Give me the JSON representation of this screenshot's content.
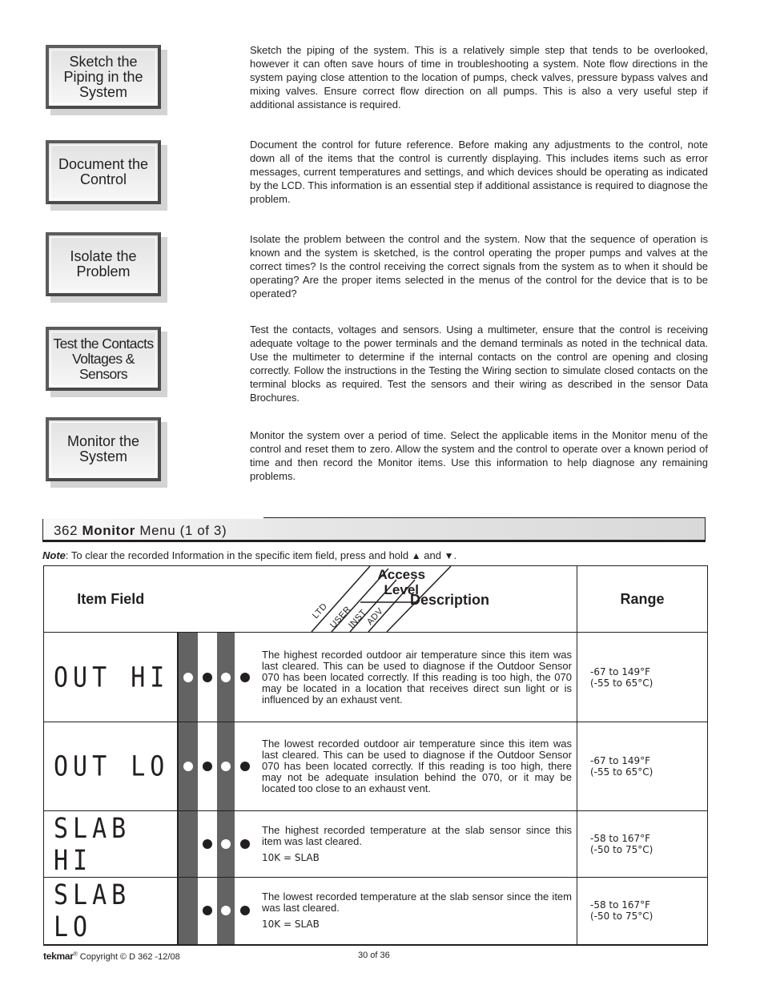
{
  "steps": [
    {
      "label": "Sketch the\nPiping in the\nSystem",
      "description": "Sketch the piping of the system. This is a relatively simple step that tends to be overlooked, however it can often save hours of time in troubleshooting a system. Note flow directions in the system paying close attention to the location of pumps, check valves, pressure bypass valves and mixing valves. Ensure correct flow direction on all pumps. This is also a very useful step if additional assistance is required."
    },
    {
      "label": "Document the\nControl",
      "description": "Document the control for future reference. Before making any adjustments to the control, note down all of the items that the control is currently displaying. This includes items such as error messages, current temperatures and settings, and which devices should be operating as indicated by the LCD. This information is an essential step if additional assistance is required to diagnose the problem."
    },
    {
      "label": "Isolate the\nProblem",
      "description": "Isolate the problem between the control and the system. Now that the sequence of operation is known and the system is sketched, is the control operating the proper pumps and valves at the correct times? Is the control receiving the correct signals from the system as to when it should be operating? Are the proper items selected in the menus of the control for the device that is to be operated?"
    },
    {
      "label": "Test the Contacts\nVoltages &\nSensors",
      "description": "Test the contacts, voltages and sensors. Using a multimeter, ensure that the control is receiving adequate voltage to the power terminals and the demand terminals as noted in the technical data. Use the multimeter to determine if the internal contacts on the control are opening and closing correctly. Follow the instructions in the Testing the Wiring section to simulate closed contacts on the terminal blocks as required. Test the sensors and their wiring as described in the sensor Data Brochures."
    },
    {
      "label": "Monitor the\nSystem",
      "description": "Monitor the system over a period of time. Select the applicable items in the Monitor menu of the control and reset them to zero. Allow the system and the control to operate over a known period of time and then record the Monitor items. Use this information to help diagnose any remaining problems."
    }
  ],
  "section": {
    "number": "362",
    "bold": "Monitor",
    "rest": "Menu (1 of 3)"
  },
  "note": {
    "label": "Note",
    "text": ": To clear the recorded Information in the specific item field, press and hold ",
    "up_icon": "▲",
    "and": " and ",
    "down_icon": "▼",
    "end": "."
  },
  "table": {
    "headers": {
      "item_field": "Item Field",
      "access_level": "Access Level",
      "access_line1": "Access",
      "access_line2": "Level",
      "levels": [
        "LTD",
        "USER",
        "INST",
        "ADV"
      ],
      "description": "Description",
      "range": "Range"
    },
    "rows": [
      {
        "display": "OUT HI",
        "access": [
          true,
          true,
          true,
          true
        ],
        "description": "The highest recorded outdoor air temperature since this item was last cleared. This can be used to diagnose if the Outdoor Sensor 070 has been located correctly. If this reading is too high, the 070 may be located in a location that receives direct sun light or is influenced by an exhaust vent.",
        "sub": "",
        "range_f": "-67 to 149°F",
        "range_c": "(-55 to 65°C)"
      },
      {
        "display": "OUT LO",
        "access": [
          true,
          true,
          true,
          true
        ],
        "description": "The lowest recorded outdoor air temperature since this item was last cleared. This can be used to diagnose if the Outdoor Sensor 070 has been located correctly. If this reading is too high, there may not be adequate insulation behind the 070, or it may be located too close to an exhaust vent.",
        "sub": "",
        "range_f": "-67 to 149°F",
        "range_c": "(-55 to 65°C)"
      },
      {
        "display": "SLAB HI",
        "access": [
          false,
          true,
          true,
          true
        ],
        "description": "The highest recorded temperature at the slab sensor since this item was last cleared.",
        "sub": "10K = SLAB",
        "range_f": "-58 to 167°F",
        "range_c": "(-50 to 75°C)"
      },
      {
        "display": "SLAB LO",
        "access": [
          false,
          true,
          true,
          true
        ],
        "description": "The lowest recorded temperature at the slab sensor since the item was last cleared.",
        "sub": "10K = SLAB",
        "range_f": "-58 to 167°F",
        "range_c": "(-50 to 75°C)"
      }
    ]
  },
  "footer": {
    "brand": "tekmar",
    "reg": "®",
    "copyright": "Copyright © D 362 -12/08",
    "page": "30 of 36"
  }
}
